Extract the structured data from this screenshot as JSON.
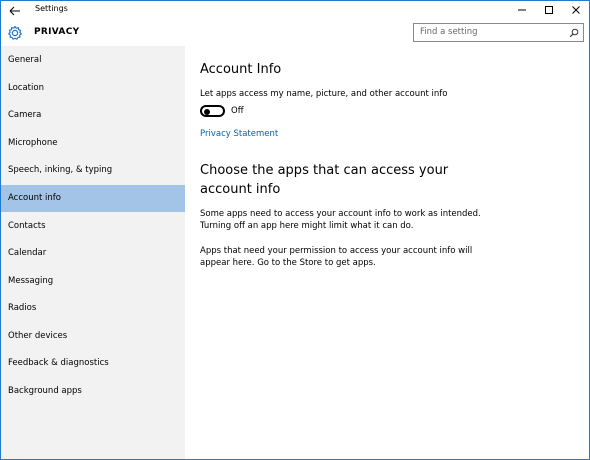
{
  "window": {
    "title": "Settings"
  },
  "header": {
    "section_title": "PRIVACY",
    "search_placeholder": "Find a setting"
  },
  "sidebar": {
    "items": [
      {
        "label": "General",
        "active": false
      },
      {
        "label": "Location",
        "active": false
      },
      {
        "label": "Camera",
        "active": false
      },
      {
        "label": "Microphone",
        "active": false
      },
      {
        "label": "Speech, inking, & typing",
        "active": false
      },
      {
        "label": "Account info",
        "active": true
      },
      {
        "label": "Contacts",
        "active": false
      },
      {
        "label": "Calendar",
        "active": false
      },
      {
        "label": "Messaging",
        "active": false
      },
      {
        "label": "Radios",
        "active": false
      },
      {
        "label": "Other devices",
        "active": false
      },
      {
        "label": "Feedback & diagnostics",
        "active": false
      },
      {
        "label": "Background apps",
        "active": false
      }
    ]
  },
  "main": {
    "heading": "Account Info",
    "toggle_description": "Let apps access my name, picture, and other account info",
    "toggle_state": "Off",
    "privacy_link": "Privacy Statement",
    "apps_heading": "Choose the apps that can access your account info",
    "paragraph1": "Some apps need to access your account info to work as intended. Turning off an app here might limit what it can do.",
    "paragraph2": "Apps that need your permission to access your account info will appear here. Go to the Store to get apps."
  },
  "colors": {
    "accent": "#0063b1",
    "active_nav": "#a3c4e6",
    "sidebar_bg": "#f2f2f2"
  }
}
